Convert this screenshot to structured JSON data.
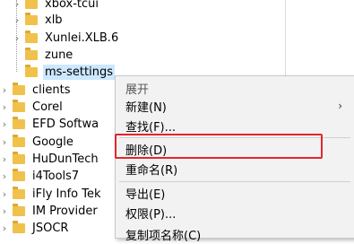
{
  "tree": {
    "items": [
      {
        "label": "xbox-tcui"
      },
      {
        "label": "xlb"
      },
      {
        "label": "Xunlei.XLB.6"
      },
      {
        "label": "zune"
      },
      {
        "label": "ms-settings"
      }
    ],
    "root_items": [
      {
        "label": "clients"
      },
      {
        "label": "Corel"
      },
      {
        "label": "EFD Softwa"
      },
      {
        "label": "Google"
      },
      {
        "label": "HuDunTech"
      },
      {
        "label": "i4Tools7"
      },
      {
        "label": "iFly Info Tek"
      },
      {
        "label": "IM Provider"
      },
      {
        "label": "JSOCR"
      }
    ]
  },
  "context_menu": {
    "expand": "展开",
    "new": "新建(N)",
    "find": "查找(F)...",
    "delete": "删除(D)",
    "rename": "重命名(R)",
    "export": "导出(E)",
    "permissions": "权限(P)...",
    "copy_key_name": "复制项名称(C)"
  },
  "colors": {
    "selection": "#cce8ff",
    "highlight_box": "#e3262b",
    "folder": "#f0c14b"
  }
}
